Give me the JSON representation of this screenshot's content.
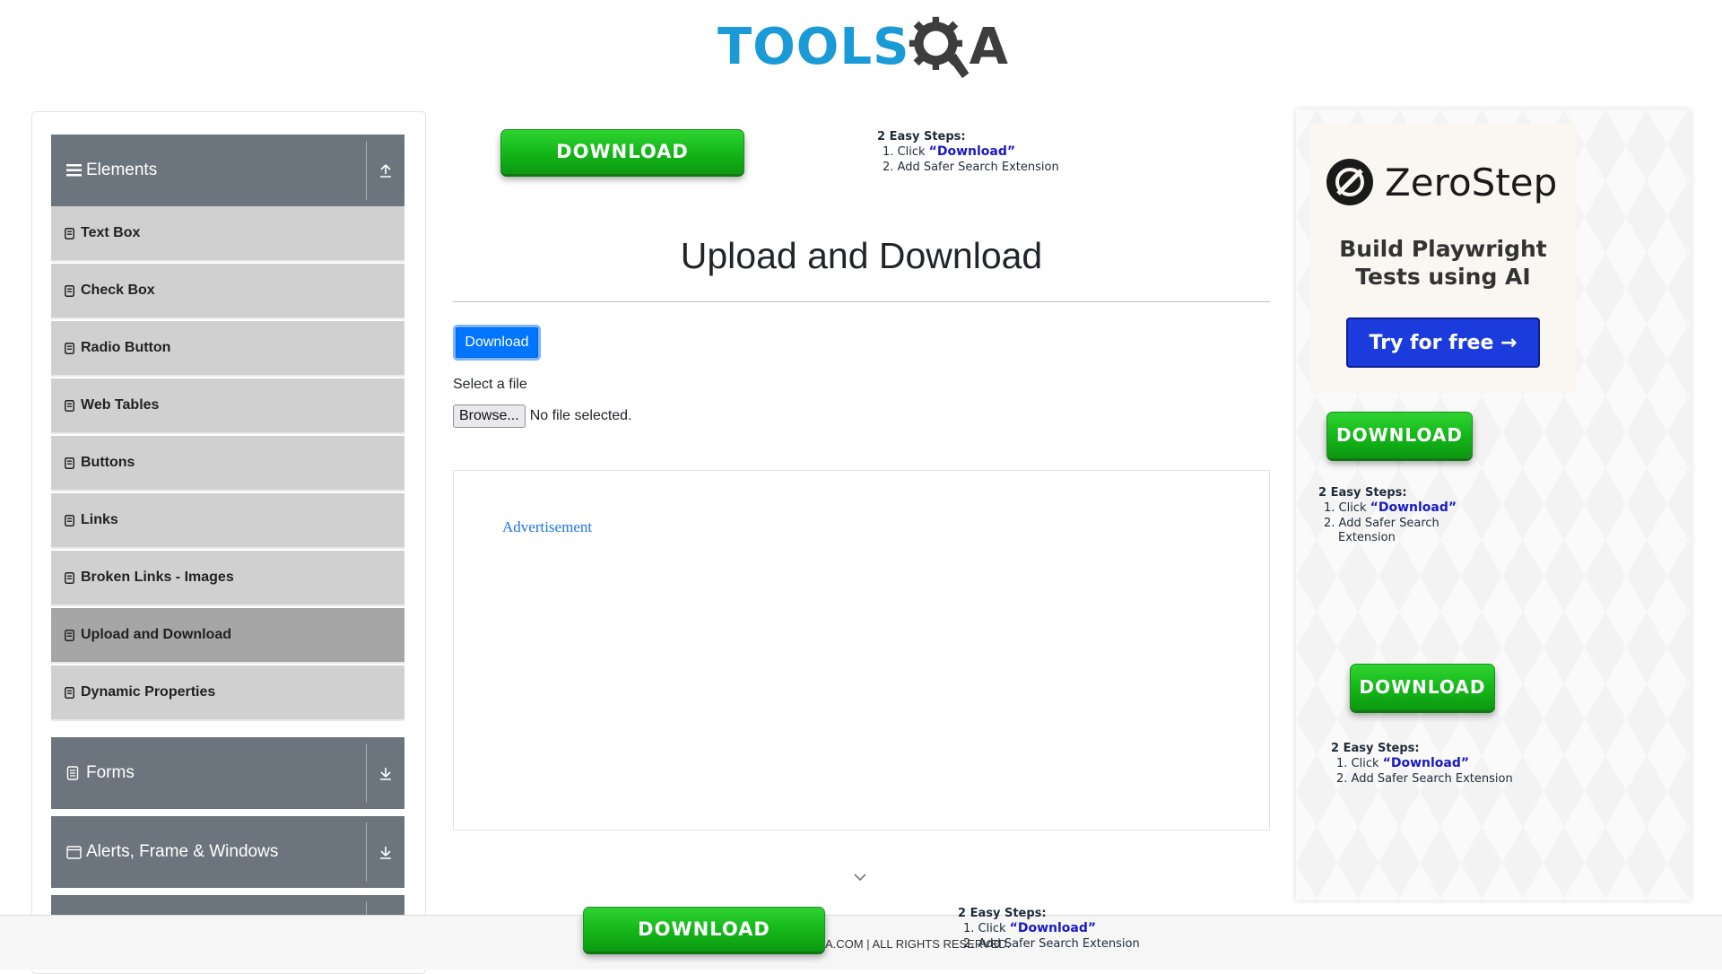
{
  "brand": {
    "logo_part1": "TOOLS",
    "logo_part2": "A",
    "blue": "#1a9ad6",
    "dark": "#3d3d3d"
  },
  "sidebar": {
    "groups": [
      {
        "label": "Elements",
        "icon": "hamburger-icon",
        "toggle": "collapse-up-icon"
      },
      {
        "label": "Forms",
        "icon": "document-icon",
        "toggle": "expand-down-icon"
      },
      {
        "label": "Alerts, Frame & Windows",
        "icon": "window-icon",
        "toggle": "expand-down-icon"
      }
    ],
    "items": [
      {
        "label": "Text Box"
      },
      {
        "label": "Check Box"
      },
      {
        "label": "Radio Button"
      },
      {
        "label": "Web Tables"
      },
      {
        "label": "Buttons"
      },
      {
        "label": "Links"
      },
      {
        "label": "Broken Links - Images"
      },
      {
        "label": "Upload and Download",
        "active": true
      },
      {
        "label": "Dynamic Properties"
      }
    ]
  },
  "main": {
    "title": "Upload and Download",
    "download_label": "Download",
    "select_label": "Select a file",
    "browse_label": "Browse...",
    "file_status": "No file selected.",
    "ad_label": "Advertisement"
  },
  "promo": {
    "button_label": "DOWNLOAD",
    "steps_title": "2 Easy Steps:",
    "step1_prefix": "1. Click ",
    "step1_quote": "“Download”",
    "step2": "2. Add Safer Search Extension",
    "step2_line1": "2. Add Safer Search",
    "step2_line2": "Extension",
    "green": "#15b81a"
  },
  "zerostep": {
    "name": "ZeroStep",
    "subtitle_line1": "Build Playwright",
    "subtitle_line2": "Tests using AI",
    "cta": "Try for free →",
    "cta_color": "#1c3bdc"
  },
  "footer": {
    "copyright": "A.COM | ALL RIGHTS RESERVED."
  }
}
